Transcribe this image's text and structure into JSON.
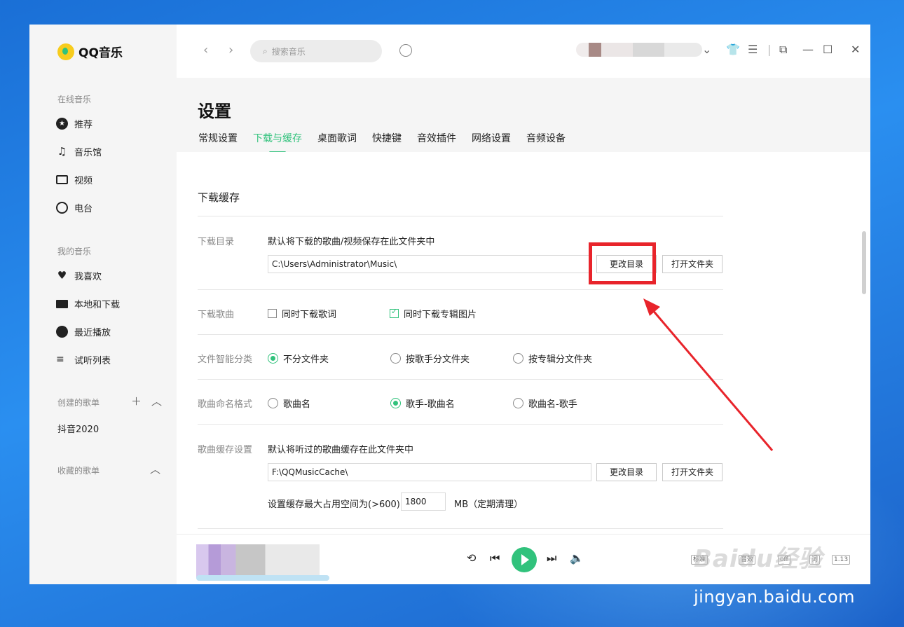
{
  "app": {
    "name": "QQ音乐"
  },
  "sidebar": {
    "online_label": "在线音乐",
    "online_items": [
      {
        "label": "推荐",
        "icon": "star-circle-icon"
      },
      {
        "label": "音乐馆",
        "icon": "music-note-icon"
      },
      {
        "label": "视频",
        "icon": "video-icon"
      },
      {
        "label": "电台",
        "icon": "radio-icon"
      }
    ],
    "my_label": "我的音乐",
    "my_items": [
      {
        "label": "我喜欢",
        "icon": "heart-icon"
      },
      {
        "label": "本地和下载",
        "icon": "monitor-icon"
      },
      {
        "label": "最近播放",
        "icon": "clock-icon"
      },
      {
        "label": "试听列表",
        "icon": "playlist-icon"
      }
    ],
    "created_label": "创建的歌单",
    "created_items": [
      {
        "label": "抖音2020"
      }
    ],
    "collected_label": "收藏的歌单"
  },
  "topbar": {
    "search_placeholder": "搜索音乐"
  },
  "settings": {
    "title": "设置",
    "tabs": [
      {
        "label": "常规设置",
        "active": false
      },
      {
        "label": "下载与缓存",
        "active": true
      },
      {
        "label": "桌面歌词",
        "active": false
      },
      {
        "label": "快捷键",
        "active": false
      },
      {
        "label": "音效插件",
        "active": false
      },
      {
        "label": "网络设置",
        "active": false
      },
      {
        "label": "音频设备",
        "active": false
      }
    ],
    "section_title": "下载缓存",
    "download_dir": {
      "label": "下载目录",
      "desc": "默认将下载的歌曲/视频保存在此文件夹中",
      "path": "C:\\Users\\Administrator\\Music\\",
      "change_btn": "更改目录",
      "open_btn": "打开文件夹"
    },
    "download_song": {
      "label": "下载歌曲",
      "options": [
        {
          "label": "同时下载歌词",
          "checked": false
        },
        {
          "label": "同时下载专辑图片",
          "checked": true
        }
      ]
    },
    "smart_classify": {
      "label": "文件智能分类",
      "options": [
        {
          "label": "不分文件夹",
          "selected": true
        },
        {
          "label": "按歌手分文件夹",
          "selected": false
        },
        {
          "label": "按专辑分文件夹",
          "selected": false
        }
      ]
    },
    "naming": {
      "label": "歌曲命名格式",
      "options": [
        {
          "label": "歌曲名",
          "selected": false
        },
        {
          "label": "歌手-歌曲名",
          "selected": true
        },
        {
          "label": "歌曲名-歌手",
          "selected": false
        }
      ]
    },
    "cache": {
      "label": "歌曲缓存设置",
      "desc": "默认将听过的歌曲缓存在此文件夹中",
      "path": "F:\\QQMusicCache\\",
      "change_btn": "更改目录",
      "open_btn": "打开文件夹",
      "limit_text": "设置缓存最大占用空间为(>600)",
      "limit_value": "1800",
      "limit_unit": "MB（定期清理）"
    }
  },
  "player": {
    "tools": [
      "标准",
      "音效",
      "off",
      "词",
      "1.13"
    ]
  },
  "watermark": {
    "logo": "Baidu经验",
    "url": "jingyan.baidu.com"
  },
  "colors": {
    "accent": "#31c27c",
    "annotation": "#e8242b"
  }
}
